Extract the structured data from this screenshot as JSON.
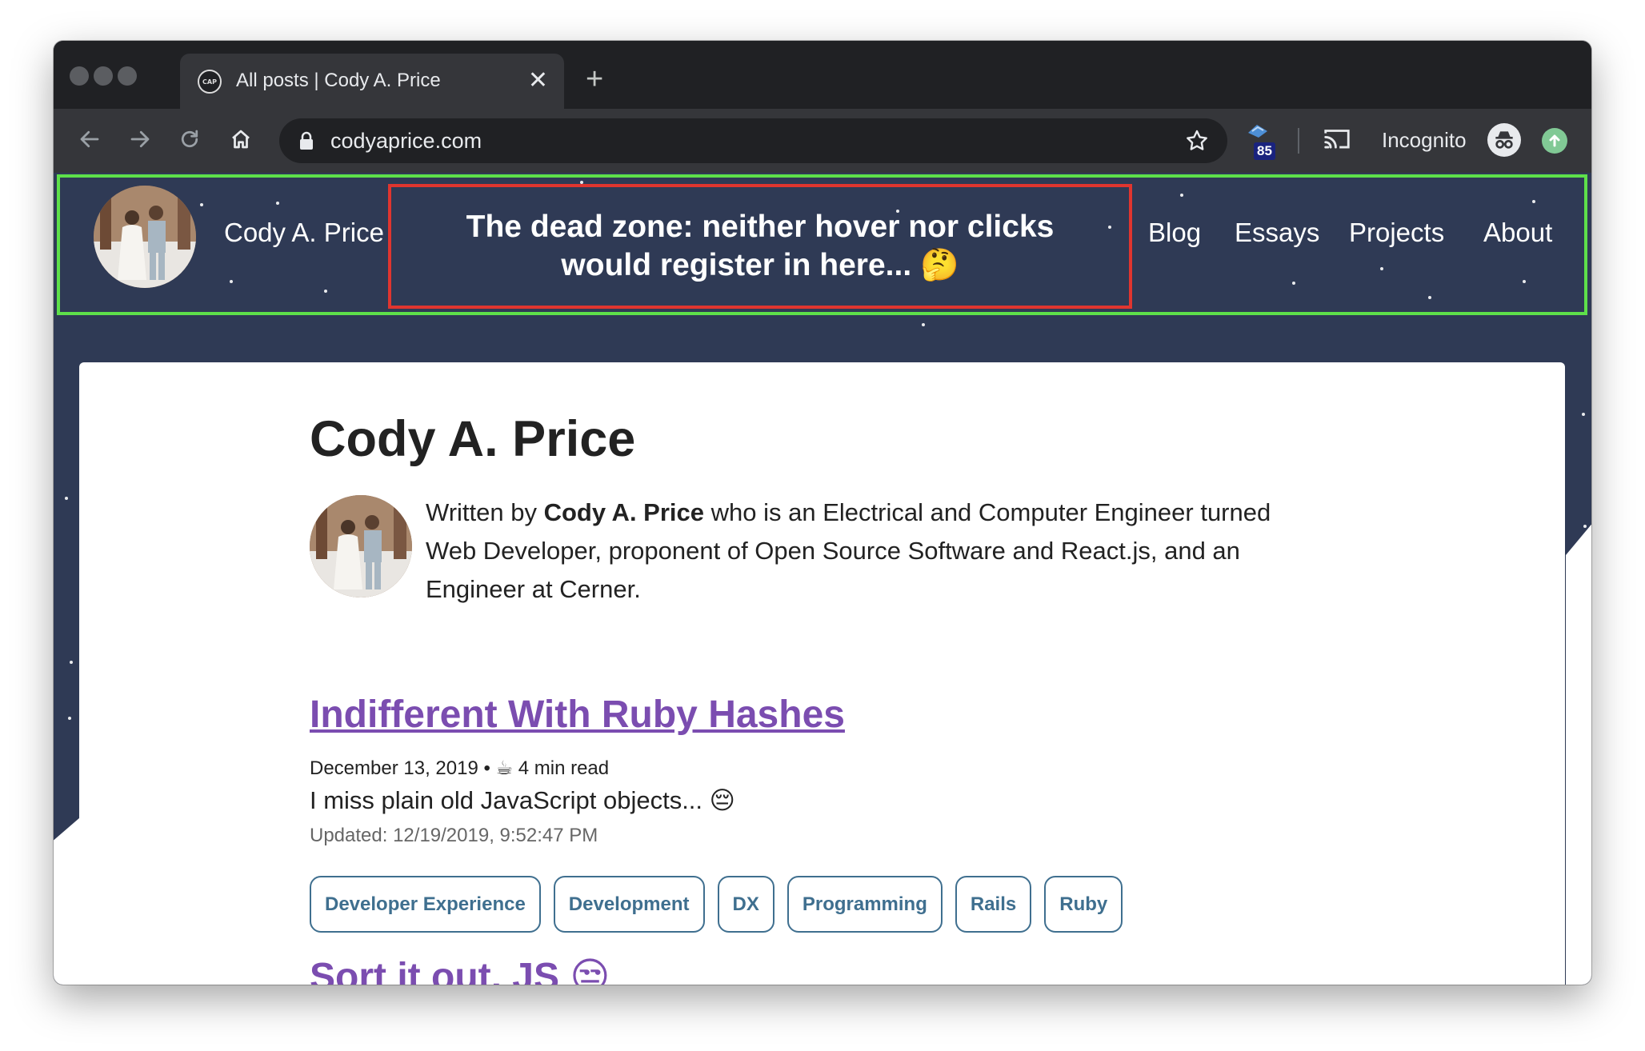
{
  "browser": {
    "tab_title": "All posts | Cody A. Price",
    "tab_favicon_text": "CAP",
    "tab_close": "✕",
    "new_tab": "+",
    "url": "codyaprice.com",
    "extension_badge": "85",
    "incognito_label": "Incognito",
    "icons": [
      "back-icon",
      "forward-icon",
      "reload-icon",
      "home-icon",
      "lock-icon",
      "bookmark-star-icon",
      "extension-icon",
      "cast-icon",
      "incognito-icon",
      "update-icon"
    ]
  },
  "site": {
    "name": "Cody A. Price",
    "annotation": "The dead zone: neither hover nor clicks would register in here... 🤔",
    "nav": [
      "Blog",
      "Essays",
      "Projects",
      "About"
    ],
    "background_color": "#2f3a55",
    "annotation_border_color": "#e0352f",
    "header_border_color": "#5ee04a"
  },
  "main": {
    "title": "Cody A. Price",
    "bio_prefix": "Written by ",
    "bio_name": "Cody A. Price",
    "bio_suffix": " who is an Electrical and Computer Engineer turned Web Developer, proponent of Open Source Software and React.js, and an Engineer at Cerner."
  },
  "posts": [
    {
      "title": "Indifferent With Ruby Hashes",
      "date": "December 13, 2019",
      "read_time_icon": "☕",
      "read_time": "4 min read",
      "description": "I miss plain old JavaScript objects... 😔",
      "updated": "Updated: 12/19/2019, 9:52:47 PM",
      "tags": [
        "Developer Experience",
        "Development",
        "DX",
        "Programming",
        "Rails",
        "Ruby"
      ]
    },
    {
      "title": "Sort it out, JS 😒"
    }
  ],
  "colors": {
    "link": "#7b4db0",
    "tag": "#3f6f8f"
  }
}
